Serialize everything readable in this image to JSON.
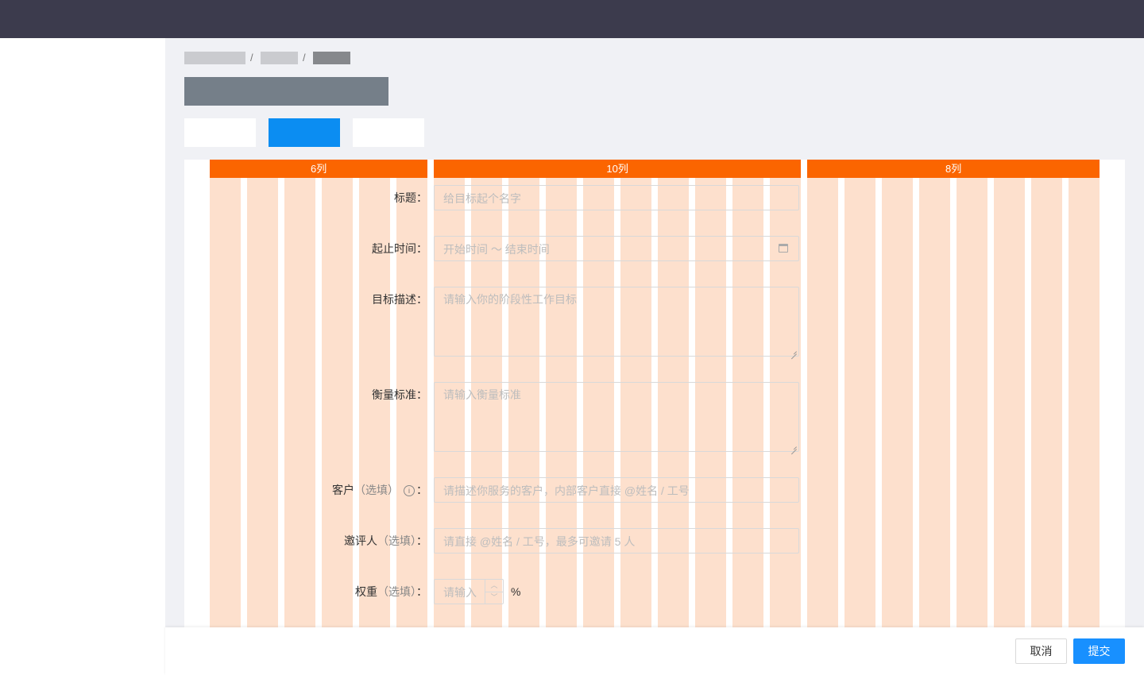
{
  "breadcrumb": {
    "separator": "/"
  },
  "grid": {
    "headers": [
      {
        "label": "6列",
        "span": 6
      },
      {
        "label": "10列",
        "span": 10
      },
      {
        "label": "8列",
        "span": 8
      }
    ],
    "header_color": "#fb6500",
    "column_color": "#fde0cd"
  },
  "form": {
    "title": {
      "label": "标题",
      "placeholder": "给目标起个名字"
    },
    "date_range": {
      "label": "起止时间",
      "placeholder": "开始时间 ～ 结束时间",
      "icon": "calendar-icon"
    },
    "goal": {
      "label": "目标描述",
      "placeholder": "请输入你的阶段性工作目标"
    },
    "standard": {
      "label": "衡量标准",
      "placeholder": "请输入衡量标准"
    },
    "client": {
      "label": "客户",
      "optional": "（选填）",
      "info_icon": "ⓘ",
      "placeholder": "请描述你服务的客户，内部客户直接 @姓名 / 工号"
    },
    "invites": {
      "label": "邀评人",
      "optional": "（选填）",
      "placeholder": "请直接 @姓名 / 工号，最多可邀请 5 人"
    },
    "weight": {
      "label": "权重",
      "optional": "（选填）",
      "placeholder": "请输入",
      "unit": "%"
    },
    "colon": "："
  },
  "footer": {
    "cancel": "取消",
    "submit": "提交",
    "accent": "#1890ff"
  }
}
